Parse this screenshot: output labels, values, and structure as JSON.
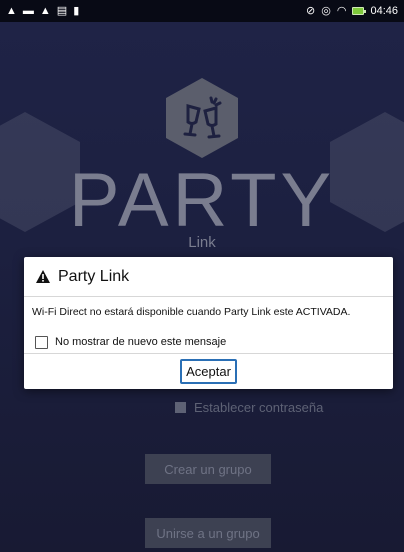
{
  "status_bar": {
    "time": "04:46",
    "left_icons": [
      "warning-icon",
      "notification-icon",
      "warning-icon",
      "tablet-icon",
      "file-icon"
    ],
    "right_icons": [
      "mute-icon",
      "alarm-icon",
      "wifi-icon",
      "battery-charging-icon"
    ]
  },
  "app": {
    "logo_title": "PARTY",
    "logo_subtitle": "Link",
    "password_checkbox_label": "Establecer contraseña",
    "create_group_label": "Crear un grupo",
    "join_group_label": "Unirse a un grupo"
  },
  "dialog": {
    "title": "Party Link",
    "message": "Wi-Fi Direct no estará disponible cuando Party Link este ACTIVADA.",
    "checkbox_label": "No mostrar de nuevo este mensaje",
    "checkbox_checked": false,
    "accept_label": "Aceptar"
  },
  "colors": {
    "background": "#1f2346",
    "accent": "#2a6fb5",
    "battery": "#7ec93b"
  }
}
